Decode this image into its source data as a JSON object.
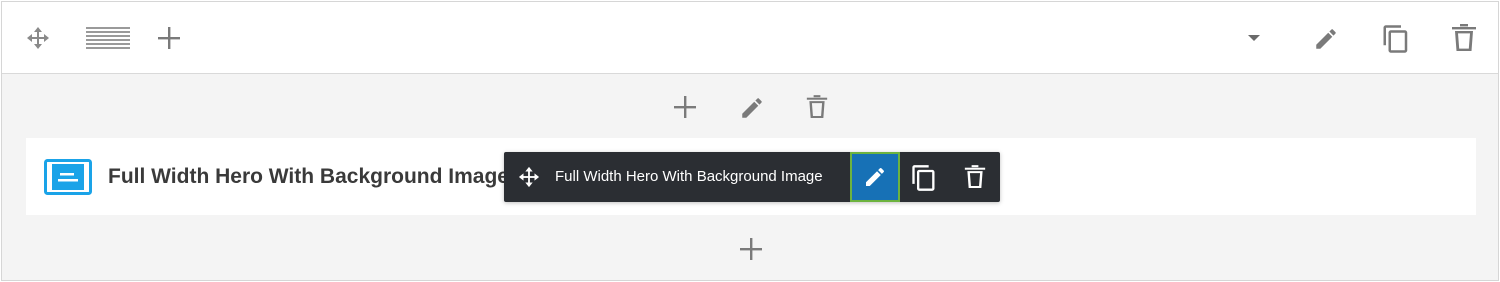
{
  "toolbar": {
    "left_icons": [
      "move-icon",
      "menu-lines-icon",
      "plus-icon"
    ],
    "right_icons": [
      "caret-down-icon",
      "pencil-icon",
      "copy-icon",
      "trash-icon"
    ]
  },
  "row_controls": {
    "icons": [
      "plus-icon",
      "pencil-icon",
      "trash-icon"
    ]
  },
  "module": {
    "icon": "module-card-icon",
    "icon_color": "#1aa3e8",
    "title": "Full Width Hero With Background Image"
  },
  "popover": {
    "label": "Full Width Hero With Background Image",
    "icons": [
      "move-icon",
      "pencil-icon",
      "copy-icon",
      "trash-icon"
    ],
    "background": "#2b2e33",
    "active_color": "#1771b6",
    "focus_outline_color": "#6db33f"
  },
  "bottom_add": {
    "icon": "plus-icon"
  }
}
